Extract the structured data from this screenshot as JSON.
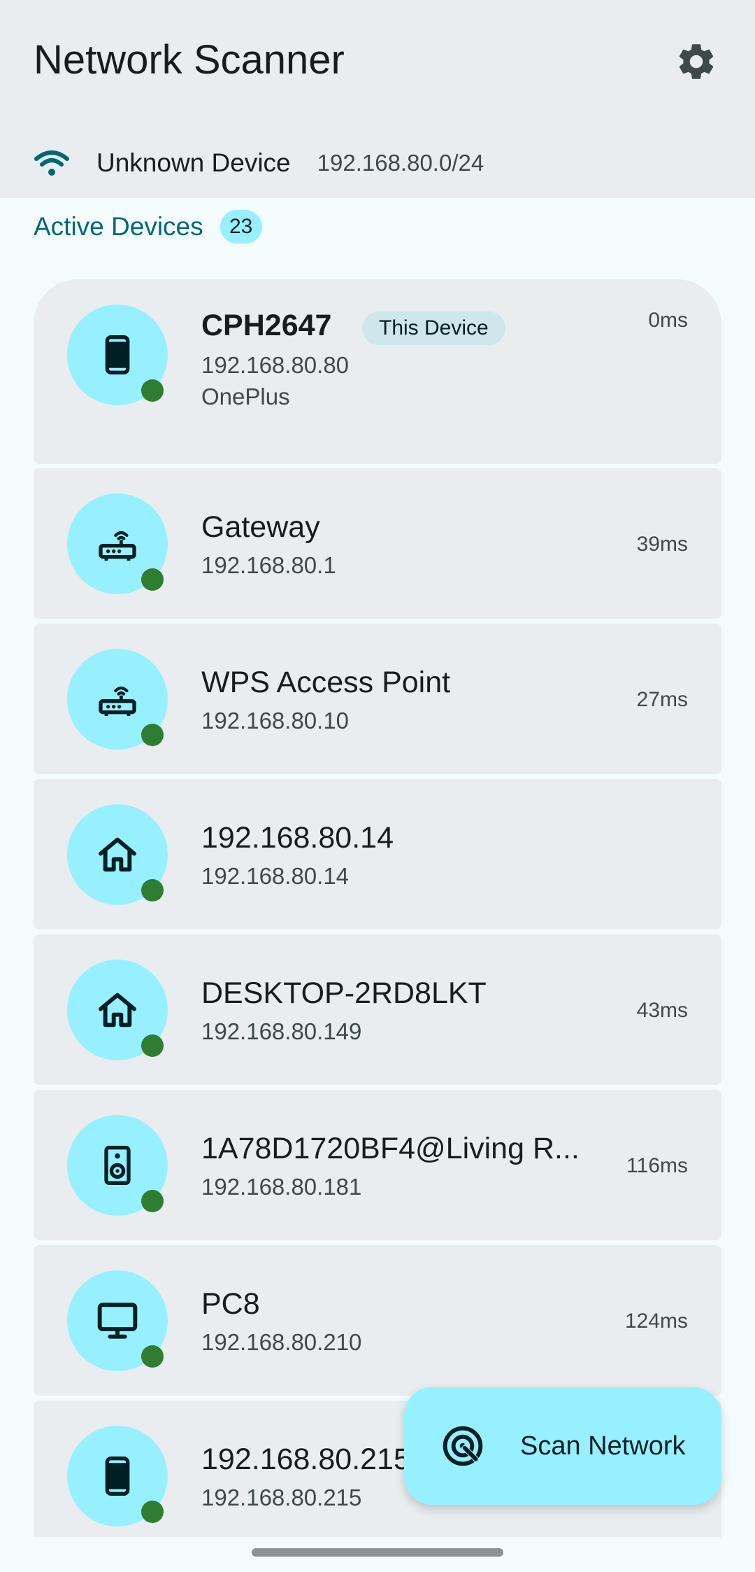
{
  "app": {
    "title": "Network Scanner",
    "settings_icon": "gear-icon"
  },
  "network": {
    "icon": "wifi-icon",
    "name": "Unknown Device",
    "subnet": "192.168.80.0/24"
  },
  "section": {
    "title": "Active Devices",
    "count": "23"
  },
  "devices": [
    {
      "name": "CPH2647",
      "badge": "This Device",
      "ip": "192.168.80.80",
      "vendor": "OnePlus",
      "latency": "0ms",
      "icon": "smartphone-icon",
      "online": true
    },
    {
      "name": "Gateway",
      "ip": "192.168.80.1",
      "latency": "39ms",
      "icon": "router-icon",
      "online": true
    },
    {
      "name": "WPS Access Point",
      "ip": "192.168.80.10",
      "latency": "27ms",
      "icon": "router-icon",
      "online": true
    },
    {
      "name": "192.168.80.14",
      "ip": "192.168.80.14",
      "latency": "",
      "icon": "home-icon",
      "online": true
    },
    {
      "name": "DESKTOP-2RD8LKT",
      "ip": "192.168.80.149",
      "latency": "43ms",
      "icon": "home-icon",
      "online": true
    },
    {
      "name": "1A78D1720BF4@Living R...",
      "ip": "192.168.80.181",
      "latency": "116ms",
      "icon": "speaker-icon",
      "online": true
    },
    {
      "name": "PC8",
      "ip": "192.168.80.210",
      "latency": "124ms",
      "icon": "desktop-icon",
      "online": true
    },
    {
      "name": "192.168.80.215",
      "ip": "192.168.80.215",
      "latency": "",
      "icon": "smartphone-icon",
      "online": true
    }
  ],
  "fab": {
    "label": "Scan Network",
    "icon": "radar-icon"
  },
  "colors": {
    "accent": "#006875",
    "avatar_bg": "#97f0ff",
    "online": "#2e7d32",
    "card_bg": "#e9edef"
  }
}
